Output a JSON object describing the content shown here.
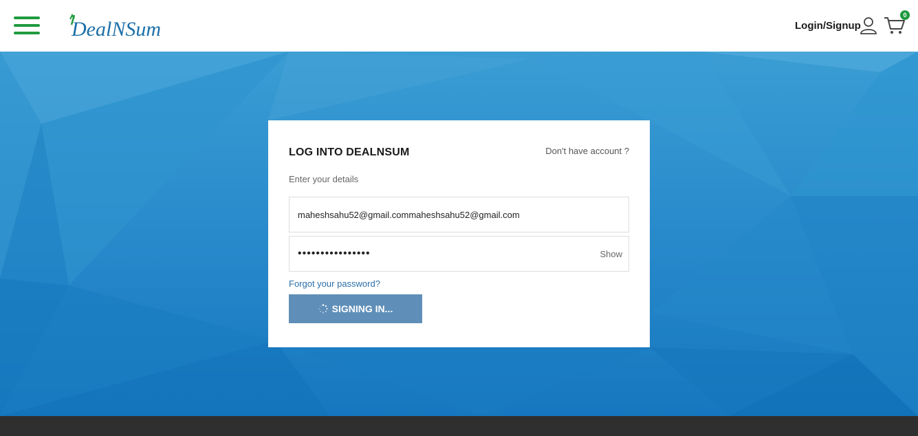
{
  "header": {
    "logo_text": "DealNSum",
    "login_label": "Login/Signup",
    "cart_count": "0",
    "brand_green": "#1f9a3f",
    "brand_blue": "#1c6fa8"
  },
  "login": {
    "title": "LOG INTO DEALNSUM",
    "no_account_label": "Don't have account ?",
    "subtitle": "Enter your details",
    "email_value": "maheshsahu52@gmail.commaheshsahu52@gmail.com",
    "password_value": "••••••••••••••••",
    "show_label": "Show",
    "forgot_label": "Forgot your password?",
    "submit_label": "SIGNING IN..."
  },
  "icons": [
    "hamburger-menu-icon",
    "user-icon",
    "cart-icon",
    "spinner-icon"
  ]
}
